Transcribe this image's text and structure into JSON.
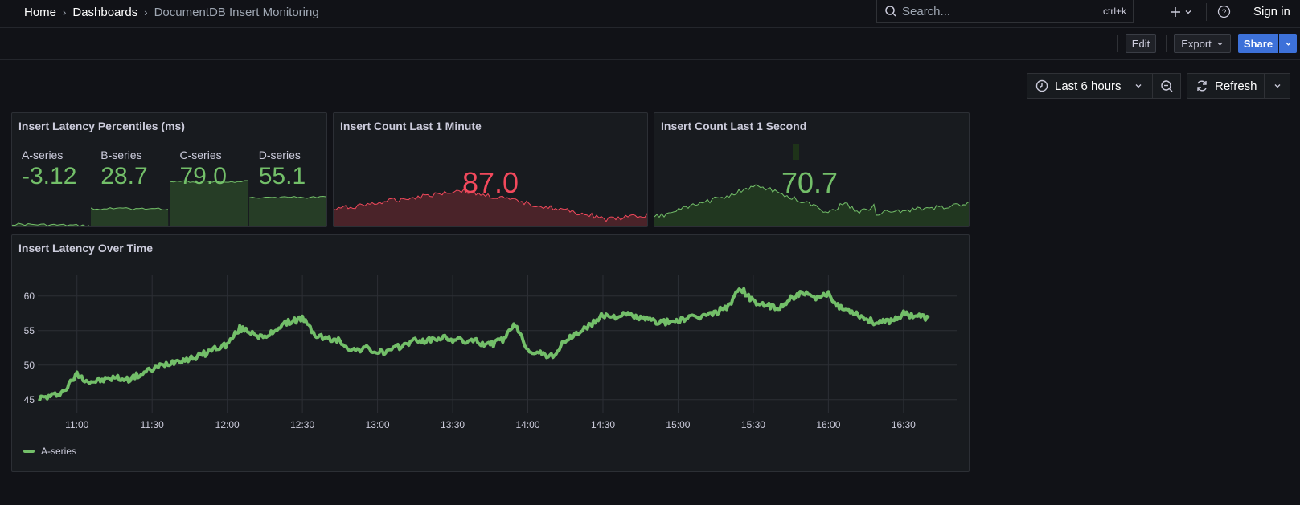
{
  "breadcrumbs": {
    "home": "Home",
    "dashboards": "Dashboards",
    "current": "DocumentDB Insert Monitoring"
  },
  "search": {
    "placeholder": "Search...",
    "shortcut": "ctrl+k"
  },
  "topbar": {
    "sign_in": "Sign in",
    "add_icon": "plus-icon",
    "help_icon": "help-circle-icon"
  },
  "toolbar": {
    "edit": "Edit",
    "export": "Export",
    "share": "Share"
  },
  "time": {
    "range": "Last 6 hours",
    "refresh": "Refresh"
  },
  "panels": {
    "percentiles": {
      "title": "Insert Latency Percentiles (ms)",
      "stats": [
        {
          "name": "A-series",
          "value": "-3.12"
        },
        {
          "name": "B-series",
          "value": "28.7"
        },
        {
          "name": "C-series",
          "value": "79.0"
        },
        {
          "name": "D-series",
          "value": "55.1"
        }
      ],
      "color": "#73bf69"
    },
    "count_minute": {
      "title": "Insert Count Last 1 Minute",
      "value": "87.0",
      "color": "#f2495c"
    },
    "count_second": {
      "title": "Insert Count Last 1 Second",
      "value": "70.7",
      "color": "#73bf69"
    },
    "latency": {
      "title": "Insert Latency Over Time",
      "legend": "A-series",
      "color": "#73bf69"
    }
  },
  "chart_data": {
    "type": "line",
    "title": "Insert Latency Over Time",
    "x": [
      "10:45",
      "10:50",
      "10:55",
      "11:00",
      "11:05",
      "11:10",
      "11:15",
      "11:20",
      "11:25",
      "11:30",
      "11:35",
      "11:40",
      "11:45",
      "11:50",
      "11:55",
      "12:00",
      "12:05",
      "12:10",
      "12:15",
      "12:20",
      "12:25",
      "12:30",
      "12:35",
      "12:40",
      "12:45",
      "12:50",
      "12:55",
      "13:00",
      "13:05",
      "13:10",
      "13:15",
      "13:20",
      "13:25",
      "13:30",
      "13:35",
      "13:40",
      "13:45",
      "13:50",
      "13:55",
      "14:00",
      "14:05",
      "14:10",
      "14:15",
      "14:20",
      "14:25",
      "14:30",
      "14:35",
      "14:40",
      "14:45",
      "14:50",
      "14:55",
      "15:00",
      "15:05",
      "15:10",
      "15:15",
      "15:20",
      "15:25",
      "15:30",
      "15:35",
      "15:40",
      "15:45",
      "15:50",
      "15:55",
      "16:00",
      "16:05",
      "16:10",
      "16:15",
      "16:20",
      "16:25",
      "16:30",
      "16:35",
      "16:40"
    ],
    "series": [
      {
        "name": "A-series",
        "values": [
          45.2,
          45.5,
          46.3,
          48.7,
          47.6,
          47.8,
          48.2,
          47.9,
          48.6,
          49.4,
          50.1,
          50.7,
          50.9,
          51.5,
          52.4,
          53.0,
          55.3,
          54.8,
          53.8,
          55.4,
          56.3,
          56.8,
          54.4,
          53.8,
          53.5,
          52.1,
          52.5,
          51.8,
          52.0,
          52.9,
          53.6,
          53.5,
          54.0,
          53.7,
          53.5,
          53.4,
          52.9,
          53.7,
          55.8,
          52.3,
          51.6,
          51.3,
          53.5,
          54.7,
          55.8,
          57.2,
          57.1,
          57.3,
          56.8,
          56.4,
          56.2,
          56.5,
          56.8,
          57.1,
          57.6,
          58.6,
          61.2,
          59.2,
          58.7,
          58.0,
          59.8,
          60.4,
          59.5,
          60.3,
          58.2,
          57.8,
          56.7,
          56.0,
          56.5,
          57.4,
          57.2,
          56.8
        ]
      }
    ],
    "x_ticks": [
      "11:00",
      "11:30",
      "12:00",
      "12:30",
      "13:00",
      "13:30",
      "14:00",
      "14:30",
      "15:00",
      "15:30",
      "16:00",
      "16:30"
    ],
    "y_ticks": [
      45,
      50,
      55,
      60
    ],
    "ylim": [
      43,
      63
    ],
    "xlabel": "",
    "ylabel": "",
    "grid": true,
    "legend": "bottom-left"
  }
}
